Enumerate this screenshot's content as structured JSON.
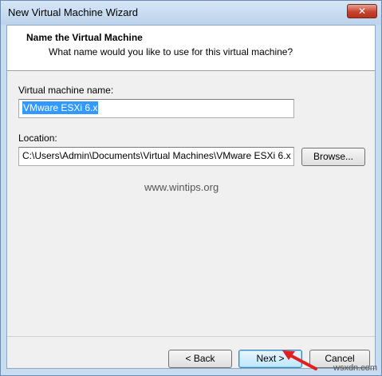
{
  "window": {
    "title": "New Virtual Machine Wizard",
    "close_label": "✕"
  },
  "header": {
    "title": "Name the Virtual Machine",
    "subtitle": "What name would you like to use for this virtual machine?"
  },
  "form": {
    "name_label": "Virtual machine name:",
    "name_value": "VMware ESXi 6.x",
    "location_label": "Location:",
    "location_value": "C:\\Users\\Admin\\Documents\\Virtual Machines\\VMware ESXi 6.x",
    "browse_label": "Browse..."
  },
  "footer": {
    "back_label": "< Back",
    "next_label": "Next >",
    "cancel_label": "Cancel"
  },
  "watermarks": {
    "site": "www.wintips.org",
    "corner": "wsxdn.com"
  },
  "colors": {
    "selection": "#3399ff",
    "annotation_arrow": "#e02020"
  }
}
